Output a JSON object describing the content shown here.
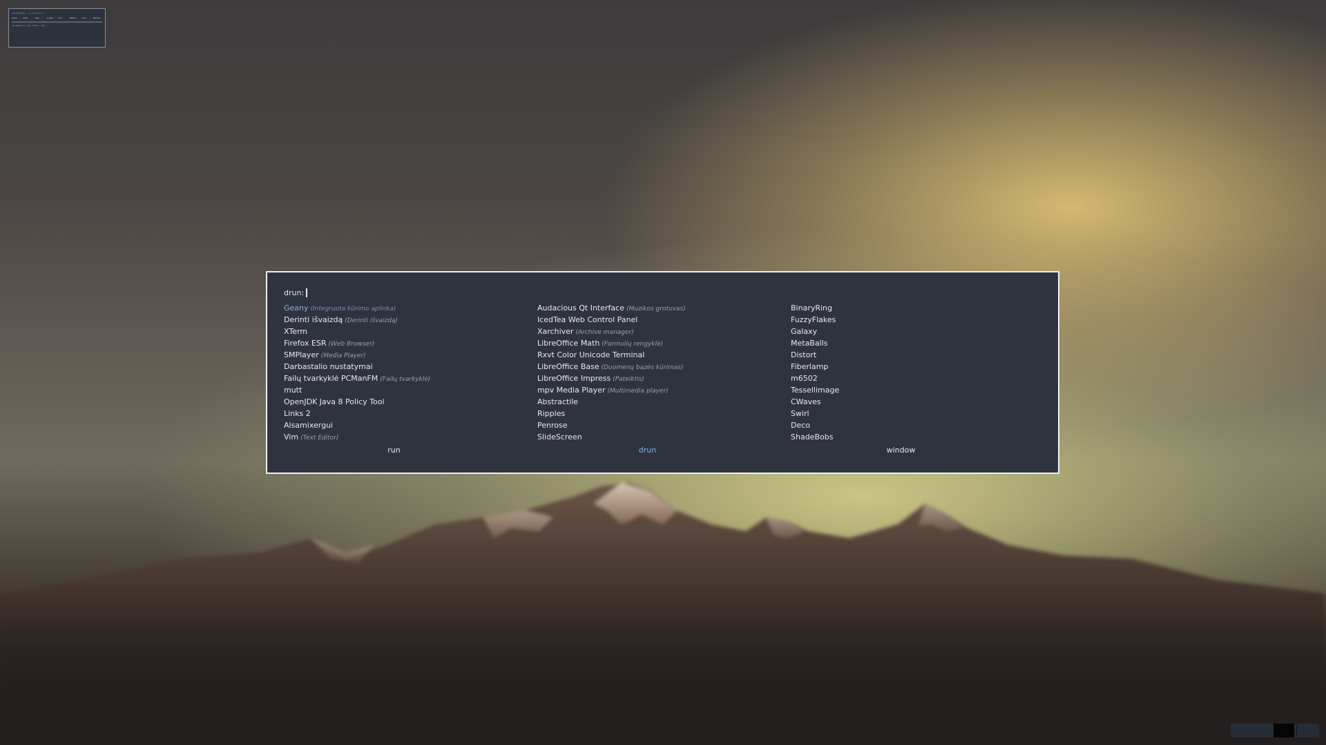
{
  "workspace_preview": {
    "title": "user@debian: ~/.config/i3",
    "headers": [
      "Brand",
      "Disk",
      "Temp",
      "Volume",
      "Wifi",
      "Memory",
      "Load",
      "Battery"
    ],
    "prompt": "user@debian:~$ cat config | less"
  },
  "launcher": {
    "prompt": "drun:",
    "input_value": "",
    "columns": [
      [
        {
          "name": "Geany",
          "sub": "(Integruota kūrimo aplinka)",
          "selected": true
        },
        {
          "name": "Derinti išvaizdą",
          "sub": "(Derinti išvaizdą)"
        },
        {
          "name": "XTerm",
          "sub": ""
        },
        {
          "name": "Firefox ESR",
          "sub": "(Web Browser)"
        },
        {
          "name": "SMPlayer",
          "sub": "(Media Player)"
        },
        {
          "name": "Darbastalio nustatymai",
          "sub": ""
        },
        {
          "name": "Failų tvarkyklė PCManFM",
          "sub": "(Failų tvarkyklė)"
        },
        {
          "name": "mutt",
          "sub": ""
        },
        {
          "name": "OpenJDK Java 8 Policy Tool",
          "sub": ""
        },
        {
          "name": "Links 2",
          "sub": ""
        },
        {
          "name": "Alsamixergui",
          "sub": ""
        },
        {
          "name": "Vim",
          "sub": "(Text Editor)"
        }
      ],
      [
        {
          "name": "Audacious Qt Interface",
          "sub": "(Muzikos grotuvas)"
        },
        {
          "name": "IcedTea Web Control Panel",
          "sub": ""
        },
        {
          "name": "Xarchiver",
          "sub": "(Archive manager)"
        },
        {
          "name": "LibreOffice Math",
          "sub": "(Formulių rengyklė)"
        },
        {
          "name": "Rxvt Color Unicode Terminal",
          "sub": ""
        },
        {
          "name": "LibreOffice Base",
          "sub": "(Duomenų bazės kūrimas)"
        },
        {
          "name": "LibreOffice Impress",
          "sub": "(Pateiktis)"
        },
        {
          "name": "mpv Media Player",
          "sub": "(Multimedia player)"
        },
        {
          "name": "Abstractile",
          "sub": ""
        },
        {
          "name": "Ripples",
          "sub": ""
        },
        {
          "name": "Penrose",
          "sub": ""
        },
        {
          "name": "SlideScreen",
          "sub": ""
        }
      ],
      [
        {
          "name": "BinaryRing",
          "sub": ""
        },
        {
          "name": "FuzzyFlakes",
          "sub": ""
        },
        {
          "name": "Galaxy",
          "sub": ""
        },
        {
          "name": "MetaBalls",
          "sub": ""
        },
        {
          "name": "Distort",
          "sub": ""
        },
        {
          "name": "Fiberlamp",
          "sub": ""
        },
        {
          "name": "m6502",
          "sub": ""
        },
        {
          "name": "Tessellimage",
          "sub": ""
        },
        {
          "name": "CWaves",
          "sub": ""
        },
        {
          "name": "Swirl",
          "sub": ""
        },
        {
          "name": "Deco",
          "sub": ""
        },
        {
          "name": "ShadeBobs",
          "sub": ""
        }
      ]
    ],
    "modes": [
      {
        "label": "run",
        "active": false
      },
      {
        "label": "drun",
        "active": true
      },
      {
        "label": "window",
        "active": false
      }
    ]
  },
  "colors": {
    "launcher_bg": "#2f333d",
    "launcher_border": "#eef0f3",
    "accent": "#89b3e0",
    "text": "#e8eaee"
  }
}
